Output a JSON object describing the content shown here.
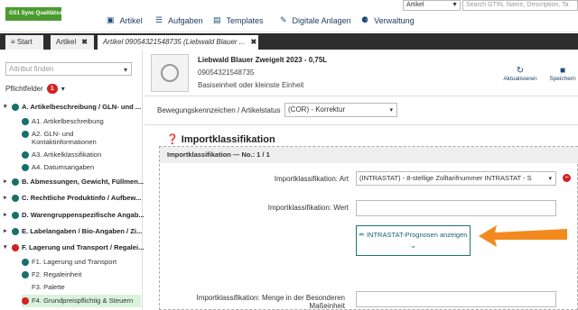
{
  "logo": "GS1 Sync  Qualitätssystem",
  "nav": {
    "items": [
      {
        "label": "Artikel",
        "icon": "cube-icon"
      },
      {
        "label": "Aufgaben",
        "icon": "tasks-icon"
      },
      {
        "label": "Templates",
        "icon": "file-icon"
      },
      {
        "label": "Digitale Anlagen",
        "icon": "paperclip-icon"
      },
      {
        "label": "Verwaltung",
        "icon": "users-icon"
      }
    ],
    "scope_select": "Artikel",
    "search_placeholder": "Search GTIN, Name, Description, Ta"
  },
  "tabs": [
    {
      "label": "Start"
    },
    {
      "label": "Artikel"
    },
    {
      "label": "Artikel 09054321548735 (Liebwald Blauer ..."
    }
  ],
  "sidebar": {
    "attr_placeholder": "Attribut finden",
    "required_label": "Pflichtfelder",
    "required_count": "1",
    "tree": [
      {
        "label": "A. Artikelbeschreibung / GLN- und ...",
        "type": "group"
      },
      {
        "label": "A1. Artikelbeschreibung",
        "type": "ok"
      },
      {
        "label": "A2. GLN- und Kontaktinformationen",
        "type": "ok"
      },
      {
        "label": "A3. Artikelklassifikation",
        "type": "ok"
      },
      {
        "label": "A4. Datumsangaben",
        "type": "ok"
      },
      {
        "label": "B. Abmessungen, Gewicht, Füllmen...",
        "type": "group"
      },
      {
        "label": "C. Rechtliche Produktinfo / Aufbew...",
        "type": "group"
      },
      {
        "label": "D. Warengruppenspezifische Angab...",
        "type": "group"
      },
      {
        "label": "E. Labelangaben / Bio-Angaben / Zi...",
        "type": "group"
      },
      {
        "label": "F. Lagerung und Transport / Regalei...",
        "type": "group"
      },
      {
        "label": "F1. Lagerung und Transport",
        "type": "ok"
      },
      {
        "label": "F2. Regaleinheit",
        "type": "ok"
      },
      {
        "label": "F3. Palette",
        "type": "plain"
      },
      {
        "label": "F4. Grundpreispflichtig & Steuern",
        "type": "err"
      }
    ]
  },
  "product": {
    "title": "Liebwald Blauer Zweigelt 2023 - 0,75L",
    "gtin": "09054321548735",
    "unit": "Basiseinheit oder kleinste Einheit"
  },
  "actions": {
    "refresh": "Aktualisieren",
    "save": "Speichern"
  },
  "main": {
    "status_label": "Bewegungskennzeichen / Artikelstatus",
    "status_value": "(COR) - Korrektur",
    "section_title": "Importklassifikation",
    "section_bar": "Importklassifikation — No.: 1 / 1",
    "art_label": "Importklassifikation: Art",
    "art_value": "(INTRASTAT) - 8-stellige Zolltarifnummer INTRASTAT - S",
    "wert_label": "Importklassifikation: Wert",
    "predict_btn": "INTRASTAT-Prognosen anzeigen",
    "menge_label": "Importklassifikation: Menge in der Besonderen Maßeinheit"
  },
  "colors": {
    "brand": "#4a9b2f",
    "ok": "#17706a",
    "error": "#d42020",
    "arrow": "#f28a1e"
  }
}
